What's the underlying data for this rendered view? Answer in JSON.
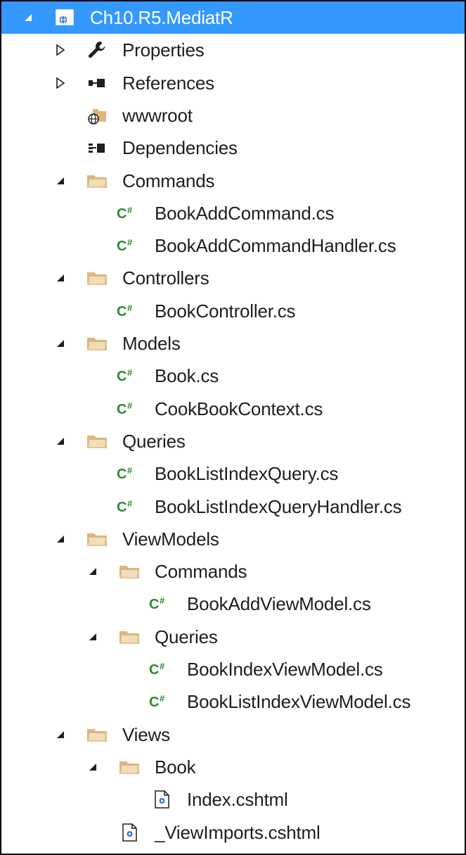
{
  "project": {
    "label": "Ch10.R5.MediatR",
    "expanded": true,
    "selected": true
  },
  "tree": [
    {
      "label": "Properties",
      "icon": "wrench-icon",
      "depth": 1,
      "toggle": "collapsed"
    },
    {
      "label": "References",
      "icon": "references-icon",
      "depth": 1,
      "toggle": "collapsed"
    },
    {
      "label": "wwwroot",
      "icon": "web-folder-icon",
      "depth": 1,
      "toggle": "none"
    },
    {
      "label": "Dependencies",
      "icon": "dependencies-icon",
      "depth": 1,
      "toggle": "none"
    },
    {
      "label": "Commands",
      "icon": "folder-icon",
      "depth": 1,
      "toggle": "expanded"
    },
    {
      "label": "BookAddCommand.cs",
      "icon": "csharp-file-icon",
      "depth": 2,
      "toggle": "none"
    },
    {
      "label": "BookAddCommandHandler.cs",
      "icon": "csharp-file-icon",
      "depth": 2,
      "toggle": "none"
    },
    {
      "label": "Controllers",
      "icon": "folder-icon",
      "depth": 1,
      "toggle": "expanded"
    },
    {
      "label": "BookController.cs",
      "icon": "csharp-file-icon",
      "depth": 2,
      "toggle": "none"
    },
    {
      "label": "Models",
      "icon": "folder-icon",
      "depth": 1,
      "toggle": "expanded"
    },
    {
      "label": "Book.cs",
      "icon": "csharp-file-icon",
      "depth": 2,
      "toggle": "none"
    },
    {
      "label": "CookBookContext.cs",
      "icon": "csharp-file-icon",
      "depth": 2,
      "toggle": "none"
    },
    {
      "label": "Queries",
      "icon": "folder-icon",
      "depth": 1,
      "toggle": "expanded"
    },
    {
      "label": "BookListIndexQuery.cs",
      "icon": "csharp-file-icon",
      "depth": 2,
      "toggle": "none"
    },
    {
      "label": "BookListIndexQueryHandler.cs",
      "icon": "csharp-file-icon",
      "depth": 2,
      "toggle": "none"
    },
    {
      "label": "ViewModels",
      "icon": "folder-icon",
      "depth": 1,
      "toggle": "expanded"
    },
    {
      "label": "Commands",
      "icon": "folder-icon",
      "depth": 2,
      "toggle": "expanded"
    },
    {
      "label": "BookAddViewModel.cs",
      "icon": "csharp-file-icon",
      "depth": 3,
      "toggle": "none"
    },
    {
      "label": "Queries",
      "icon": "folder-icon",
      "depth": 2,
      "toggle": "expanded"
    },
    {
      "label": "BookIndexViewModel.cs",
      "icon": "csharp-file-icon",
      "depth": 3,
      "toggle": "none"
    },
    {
      "label": "BookListIndexViewModel.cs",
      "icon": "csharp-file-icon",
      "depth": 3,
      "toggle": "none"
    },
    {
      "label": "Views",
      "icon": "folder-icon",
      "depth": 1,
      "toggle": "expanded"
    },
    {
      "label": "Book",
      "icon": "folder-icon",
      "depth": 2,
      "toggle": "expanded"
    },
    {
      "label": "Index.cshtml",
      "icon": "razor-file-icon",
      "depth": 3,
      "toggle": "none"
    },
    {
      "label": "_ViewImports.cshtml",
      "icon": "razor-file-icon",
      "depth": 2,
      "toggle": "none"
    }
  ],
  "colors": {
    "selection": "#3399ff",
    "folder": "#dcb67a",
    "csharp": "#2e8b2e",
    "text": "#1e1e1e"
  }
}
